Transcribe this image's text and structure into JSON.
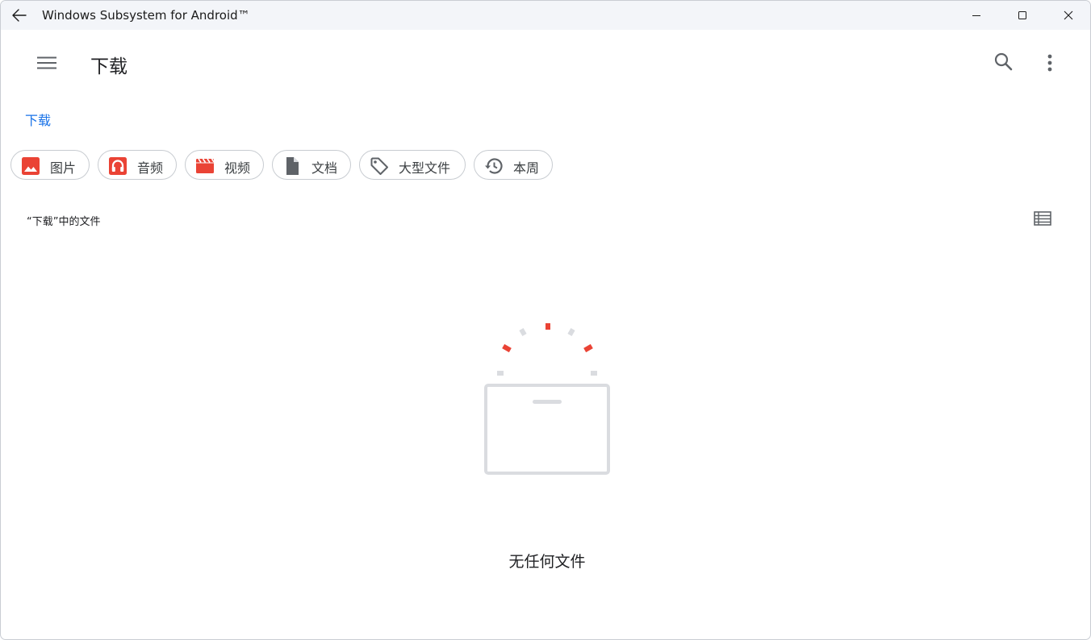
{
  "window": {
    "title": "Windows Subsystem for Android™",
    "icons": {
      "back": "arrow-left-icon",
      "minimize": "minimize-icon",
      "maximize": "maximize-icon",
      "close": "close-icon"
    }
  },
  "appbar": {
    "title": "下载",
    "icons": {
      "menu": "hamburger-menu-icon",
      "search": "search-icon",
      "more": "more-vertical-icon"
    }
  },
  "breadcrumb": {
    "current": "下载"
  },
  "chips": [
    {
      "label": "图片",
      "icon": "image-icon"
    },
    {
      "label": "音频",
      "icon": "headphones-icon"
    },
    {
      "label": "视频",
      "icon": "movie-clapper-icon"
    },
    {
      "label": "文档",
      "icon": "document-icon"
    },
    {
      "label": "大型文件",
      "icon": "tag-icon"
    },
    {
      "label": "本周",
      "icon": "history-icon"
    }
  ],
  "section": {
    "label": "“下载”中的文件",
    "view_toggle_icon": "list-view-icon"
  },
  "empty_state": {
    "message": "无任何文件",
    "icon": "empty-box-icon"
  },
  "colors": {
    "accent": "#1a73e8",
    "chip_icon_red": "#ea4335",
    "chip_icon_gray": "#5f6368",
    "titlebar_bg": "#f3f5f9"
  }
}
